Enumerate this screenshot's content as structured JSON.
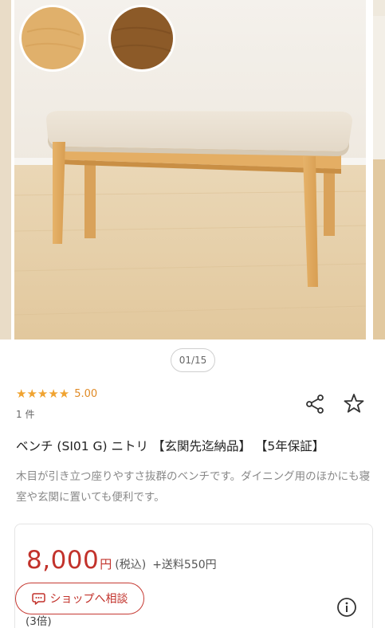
{
  "gallery": {
    "pager": "01/15",
    "swatches": [
      {
        "name": "natural",
        "color": "#e0b06b"
      },
      {
        "name": "medium-brown",
        "color": "#8c5a28"
      }
    ]
  },
  "rating": {
    "stars": "★★★★★",
    "value": "5.00",
    "count": "1 件"
  },
  "product": {
    "title": "ベンチ (SI01 G) ニトリ 【玄関先迄納品】 【5年保証】",
    "description": "木目が引き立つ座りやすさ抜群のベンチです。ダイニング用のほかにも寝室や玄関に置いても便利です。"
  },
  "price": {
    "amount": "8,000",
    "yen": "円",
    "tax": "(税込)",
    "shipping": "+送料550円"
  },
  "shop_button": {
    "label": "ショップへ相談"
  },
  "points_text": "(3倍)",
  "colors": {
    "price_red": "#c2322b",
    "star_orange": "#f0a330"
  }
}
